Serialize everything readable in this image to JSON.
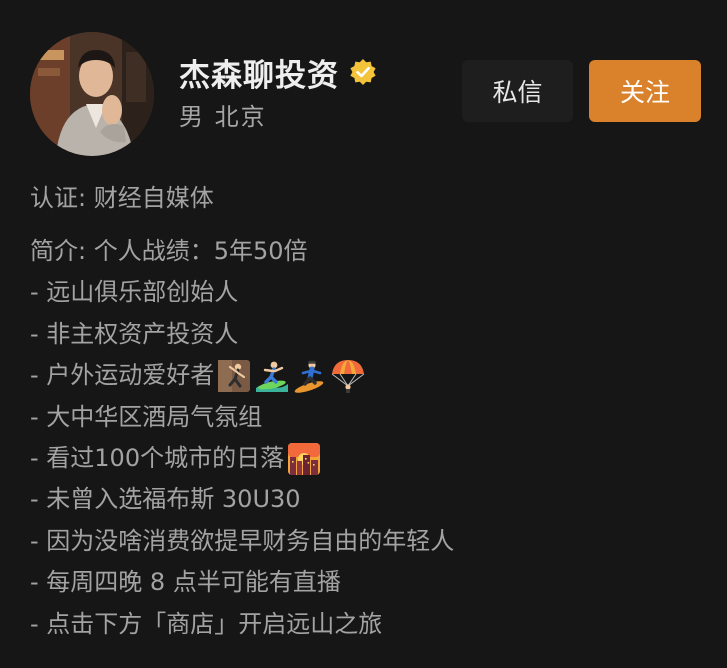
{
  "profile": {
    "name": "杰森聊投资",
    "location": "男  北京",
    "verified_icon": "verified-badge-icon",
    "verified_color": "#f3c33a"
  },
  "actions": {
    "message_label": "私信",
    "follow_label": "关注",
    "follow_color": "#d9822b"
  },
  "certification": "认证: 财经自媒体",
  "bio": {
    "intro": "简介: 个人战绩：5年50倍",
    "items": [
      "- 远山俱乐部创始人",
      "- 非主权资产投资人",
      "- 户外运动爱好者",
      "- 大中华区酒局气氛组",
      "- 看过100个城市的日落",
      "- 未曾入选福布斯 30U30",
      "- 因为没啥消费欲提早财务自由的年轻人",
      "- 每周四晚 8 点半可能有直播",
      "- 点击下方「商店」开启远山之旅"
    ],
    "outdoor_emojis": [
      "rock-climbing-icon",
      "surfing-icon",
      "snowboarding-icon",
      "parachute-icon"
    ],
    "sunset_emoji": "city-sunset-icon"
  }
}
